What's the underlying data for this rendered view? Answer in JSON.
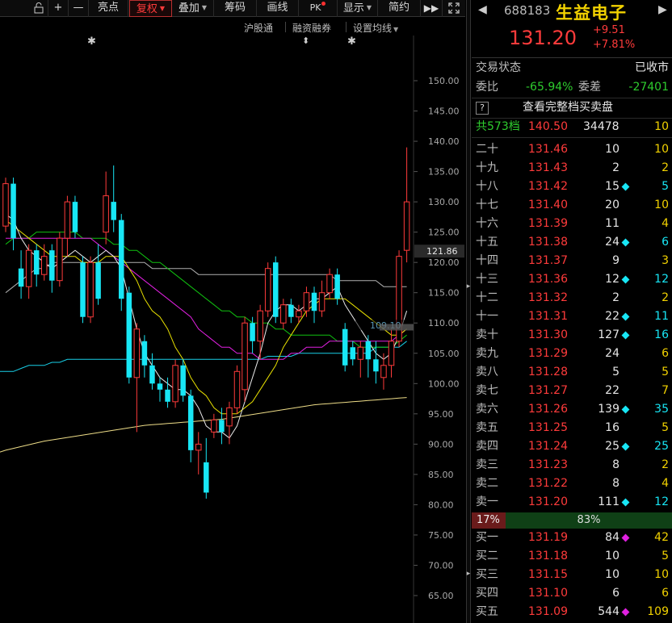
{
  "toolbar": {
    "items": [
      {
        "label": "",
        "icon": "lock-icon"
      },
      {
        "label": "+",
        "icon": "plus-icon"
      },
      {
        "label": "—",
        "icon": "minus-icon"
      },
      {
        "label": "亮点"
      },
      {
        "label": "复权",
        "active": true,
        "caret": true
      },
      {
        "label": "叠加",
        "caret": true
      },
      {
        "label": "筹码"
      },
      {
        "label": "画线"
      },
      {
        "label": "PK"
      },
      {
        "label": "显示",
        "caret": true
      },
      {
        "label": "简约"
      }
    ],
    "more_icon": "double-chevron-right-icon",
    "fullscreen_icon": "fullscreen-icon"
  },
  "chart_options": {
    "hgt": "沪股通",
    "margin": "融资融券",
    "ma_settings": "设置均线",
    "markers": [
      "✱",
      "⬍",
      "✱"
    ]
  },
  "chart": {
    "price_axis": [
      "150.00",
      "145.00",
      "140.00",
      "135.00",
      "130.00",
      "125.00",
      "120.00",
      "115.00",
      "110.00",
      "105.00",
      "100.00",
      "95.00",
      "90.00",
      "85.00",
      "80.00",
      "75.00",
      "70.00",
      "65.00"
    ],
    "current_price_tag": "121.86",
    "annotation": "109.10",
    "colors": {
      "up": "#ff3b3b",
      "down": "#18e6f5",
      "ma5": "#e8e8e8",
      "ma10": "#e8e000",
      "ma20": "#e020e0",
      "ma30": "#10c010",
      "ma60": "#b0b0b0",
      "ma120": "#18d0e8",
      "ma250": "#eedd88"
    }
  },
  "chart_data": {
    "type": "candlestick",
    "ylim": [
      62,
      153
    ],
    "candles": [
      {
        "o": 126,
        "c": 133,
        "h": 134,
        "l": 125
      },
      {
        "o": 133,
        "c": 124,
        "h": 134,
        "l": 122
      },
      {
        "o": 119,
        "c": 116,
        "h": 122,
        "l": 114
      },
      {
        "o": 116,
        "c": 122,
        "h": 123,
        "l": 114
      },
      {
        "o": 122,
        "c": 118,
        "h": 123,
        "l": 116
      },
      {
        "o": 118,
        "c": 121,
        "h": 123,
        "l": 117
      },
      {
        "o": 122,
        "c": 117,
        "h": 123,
        "l": 115
      },
      {
        "o": 117,
        "c": 124,
        "h": 125,
        "l": 116
      },
      {
        "o": 124,
        "c": 130,
        "h": 131,
        "l": 121
      },
      {
        "o": 130,
        "c": 125,
        "h": 131,
        "l": 124
      },
      {
        "o": 120,
        "c": 111,
        "h": 121,
        "l": 110
      },
      {
        "o": 111,
        "c": 120,
        "h": 121,
        "l": 110
      },
      {
        "o": 120,
        "c": 114,
        "h": 123,
        "l": 113
      },
      {
        "o": 125,
        "c": 131,
        "h": 135,
        "l": 123
      },
      {
        "o": 130,
        "c": 127,
        "h": 136,
        "l": 125
      },
      {
        "o": 127,
        "c": 114,
        "h": 128,
        "l": 112
      },
      {
        "o": 115,
        "c": 101,
        "h": 116,
        "l": 100
      },
      {
        "o": 101,
        "c": 109,
        "h": 110,
        "l": 92
      },
      {
        "o": 107,
        "c": 103,
        "h": 108,
        "l": 101
      },
      {
        "o": 103,
        "c": 100,
        "h": 105,
        "l": 99
      },
      {
        "o": 100,
        "c": 99,
        "h": 101,
        "l": 97
      },
      {
        "o": 99,
        "c": 97,
        "h": 101,
        "l": 96
      },
      {
        "o": 97,
        "c": 103,
        "h": 104,
        "l": 96
      },
      {
        "o": 103,
        "c": 98,
        "h": 104,
        "l": 97
      },
      {
        "o": 98,
        "c": 89,
        "h": 99,
        "l": 87
      },
      {
        "o": 89,
        "c": 90,
        "h": 92,
        "l": 85
      },
      {
        "o": 87,
        "c": 82,
        "h": 91,
        "l": 81
      },
      {
        "o": 92,
        "c": 94,
        "h": 95,
        "l": 91
      },
      {
        "o": 94,
        "c": 92,
        "h": 96,
        "l": 90
      },
      {
        "o": 93,
        "c": 96,
        "h": 97,
        "l": 90
      },
      {
        "o": 96,
        "c": 102,
        "h": 103,
        "l": 95
      },
      {
        "o": 99,
        "c": 110,
        "h": 111,
        "l": 97
      },
      {
        "o": 110,
        "c": 107,
        "h": 111,
        "l": 105
      },
      {
        "o": 107,
        "c": 112,
        "h": 113,
        "l": 104
      },
      {
        "o": 112,
        "c": 119,
        "h": 120,
        "l": 111
      },
      {
        "o": 120,
        "c": 111,
        "h": 121,
        "l": 110
      },
      {
        "o": 110,
        "c": 113,
        "h": 114,
        "l": 109
      },
      {
        "o": 113,
        "c": 111,
        "h": 114,
        "l": 110
      },
      {
        "o": 111,
        "c": 112,
        "h": 113,
        "l": 110
      },
      {
        "o": 112,
        "c": 115,
        "h": 116,
        "l": 111
      },
      {
        "o": 115,
        "c": 112,
        "h": 116,
        "l": 110
      },
      {
        "o": 112,
        "c": 115,
        "h": 117,
        "l": 111
      },
      {
        "o": 115,
        "c": 118,
        "h": 119,
        "l": 114
      },
      {
        "o": 118,
        "c": 114,
        "h": 119,
        "l": 113
      },
      {
        "o": 109,
        "c": 103,
        "h": 110,
        "l": 102
      },
      {
        "o": 106,
        "c": 104,
        "h": 107,
        "l": 103
      },
      {
        "o": 104,
        "c": 106,
        "h": 107,
        "l": 101
      },
      {
        "o": 107,
        "c": 104,
        "h": 108,
        "l": 101
      },
      {
        "o": 104,
        "c": 102,
        "h": 107,
        "l": 100
      },
      {
        "o": 101,
        "c": 103,
        "h": 105,
        "l": 99
      },
      {
        "o": 103,
        "c": 107,
        "h": 109,
        "l": 101
      },
      {
        "o": 107,
        "c": 121,
        "h": 122,
        "l": 106
      },
      {
        "o": 122,
        "c": 130,
        "h": 139,
        "l": 120
      }
    ],
    "ma5": [
      128,
      127,
      124,
      122,
      121,
      120,
      119,
      120,
      121,
      122,
      121,
      120,
      121,
      122,
      121,
      119,
      114,
      109,
      105,
      103,
      101,
      100,
      99,
      99,
      98,
      96,
      93,
      92,
      92,
      91,
      93,
      97,
      101,
      105,
      110,
      112,
      113,
      113,
      112,
      113,
      114,
      114,
      115,
      116,
      113,
      111,
      109,
      107,
      105,
      104,
      105,
      108,
      112
    ],
    "ma10": [
      127,
      126,
      125,
      124,
      123,
      122,
      121,
      121,
      121,
      121,
      120,
      120,
      120,
      121,
      121,
      121,
      119,
      117,
      114,
      112,
      111,
      109,
      106,
      104,
      101,
      99,
      98,
      96,
      95,
      95,
      95,
      96,
      97,
      99,
      101,
      103,
      106,
      108,
      110,
      112,
      113,
      114,
      114,
      114,
      114,
      113,
      112,
      111,
      110,
      109,
      108,
      108,
      109
    ],
    "ma20": [
      124,
      124,
      124,
      124,
      124,
      124,
      124,
      124,
      124,
      124,
      124,
      124,
      123,
      122,
      121,
      120,
      119,
      118,
      117,
      116,
      115,
      114,
      113,
      112,
      111,
      109,
      108,
      107,
      106,
      106,
      105,
      105,
      105,
      104,
      104,
      104,
      104,
      105,
      105,
      106,
      106,
      106,
      107,
      107,
      107,
      107,
      107,
      107,
      107,
      107,
      107,
      108,
      109
    ],
    "ma30": [
      123,
      124,
      124,
      124,
      125,
      125,
      125,
      125,
      125,
      125,
      124,
      124,
      124,
      124,
      123,
      123,
      122,
      122,
      121,
      120,
      120,
      119,
      118,
      117,
      116,
      115,
      114,
      113,
      112,
      112,
      111,
      111,
      110,
      110,
      110,
      109,
      109,
      108,
      108,
      108,
      108,
      108,
      108,
      107,
      107,
      107,
      106,
      106,
      106,
      106,
      106,
      107,
      108
    ],
    "ma60": [
      115,
      116,
      117,
      118,
      119,
      119,
      120,
      120,
      120,
      120,
      120,
      120,
      120,
      120,
      120,
      120,
      120,
      120,
      120,
      119,
      119,
      119,
      119,
      119,
      119,
      118,
      118,
      118,
      118,
      118,
      118,
      118,
      118,
      118,
      118,
      118,
      118,
      118,
      118,
      118,
      118,
      118,
      118,
      117,
      117,
      117,
      117,
      117,
      117,
      116,
      116,
      116,
      116
    ],
    "ma120": [
      102,
      102,
      102.5,
      103,
      103,
      103,
      103.5,
      103.5,
      104,
      104,
      104,
      104,
      104,
      104,
      104,
      104,
      104,
      104,
      104,
      104,
      104,
      104,
      104,
      104,
      104,
      104,
      104,
      104,
      104,
      104,
      104,
      104,
      104,
      104,
      104.5,
      104.5,
      104.5,
      104.5,
      105,
      105,
      105,
      105,
      105,
      105,
      105,
      105,
      105,
      105,
      106,
      106,
      106,
      106,
      107
    ],
    "ma250": [
      89,
      89.3,
      89.6,
      89.9,
      90.2,
      90.5,
      90.7,
      90.9,
      91.1,
      91.3,
      91.5,
      91.7,
      91.9,
      92.1,
      92.3,
      92.5,
      92.7,
      92.9,
      93.1,
      93.2,
      93.3,
      93.4,
      93.5,
      93.6,
      93.7,
      93.8,
      93.9,
      94,
      94.1,
      94.3,
      94.5,
      94.7,
      94.9,
      95.1,
      95.3,
      95.5,
      95.7,
      95.9,
      96.1,
      96.3,
      96.5,
      96.6,
      96.7,
      96.8,
      96.9,
      97,
      97.1,
      97.2,
      97.3,
      97.4,
      97.5,
      97.6,
      97.7
    ]
  },
  "panel": {
    "code": "688183",
    "name": "生益电子",
    "price": "131.20",
    "change": "+9.51",
    "change_pct": "+7.81%",
    "status_label": "交易状态",
    "status_value": "已收市",
    "wb_label": "委比",
    "wb_value": "-65.94%",
    "wc_label": "委差",
    "wc_value": "-27401",
    "full_book": "查看完整档买卖盘",
    "total_levels": "共573档",
    "total_price": "140.50",
    "total_vol": "34478",
    "total_cnt": "10",
    "asks": [
      {
        "label": "二十",
        "price": "131.46",
        "vol": "10",
        "cnt": "10",
        "dot": ""
      },
      {
        "label": "十九",
        "price": "131.43",
        "vol": "2",
        "cnt": "2",
        "dot": ""
      },
      {
        "label": "十八",
        "price": "131.42",
        "vol": "15",
        "cnt": "5",
        "dot": "#18e6f5"
      },
      {
        "label": "十七",
        "price": "131.40",
        "vol": "20",
        "cnt": "10",
        "dot": ""
      },
      {
        "label": "十六",
        "price": "131.39",
        "vol": "11",
        "cnt": "4",
        "dot": ""
      },
      {
        "label": "十五",
        "price": "131.38",
        "vol": "24",
        "cnt": "6",
        "dot": "#18e6f5"
      },
      {
        "label": "十四",
        "price": "131.37",
        "vol": "9",
        "cnt": "3",
        "dot": ""
      },
      {
        "label": "十三",
        "price": "131.36",
        "vol": "12",
        "cnt": "12",
        "dot": "#18e6f5"
      },
      {
        "label": "十二",
        "price": "131.32",
        "vol": "2",
        "cnt": "2",
        "dot": ""
      },
      {
        "label": "十一",
        "price": "131.31",
        "vol": "22",
        "cnt": "11",
        "dot": "#18e6f5"
      },
      {
        "label": "卖十",
        "price": "131.30",
        "vol": "127",
        "cnt": "16",
        "dot": "#18e6f5"
      },
      {
        "label": "卖九",
        "price": "131.29",
        "vol": "24",
        "cnt": "6",
        "dot": ""
      },
      {
        "label": "卖八",
        "price": "131.28",
        "vol": "5",
        "cnt": "5",
        "dot": ""
      },
      {
        "label": "卖七",
        "price": "131.27",
        "vol": "22",
        "cnt": "7",
        "dot": ""
      },
      {
        "label": "卖六",
        "price": "131.26",
        "vol": "139",
        "cnt": "35",
        "dot": "#18e6f5"
      },
      {
        "label": "卖五",
        "price": "131.25",
        "vol": "16",
        "cnt": "5",
        "dot": ""
      },
      {
        "label": "卖四",
        "price": "131.24",
        "vol": "25",
        "cnt": "25",
        "dot": "#18e6f5"
      },
      {
        "label": "卖三",
        "price": "131.23",
        "vol": "8",
        "cnt": "2",
        "dot": ""
      },
      {
        "label": "卖二",
        "price": "131.22",
        "vol": "8",
        "cnt": "4",
        "dot": ""
      },
      {
        "label": "卖一",
        "price": "131.20",
        "vol": "111",
        "cnt": "12",
        "dot": "#18e6f5"
      }
    ],
    "ratio_left": "17%",
    "ratio_right": "83%",
    "bids": [
      {
        "label": "买一",
        "price": "131.19",
        "vol": "84",
        "cnt": "42",
        "dot": "#e020e0"
      },
      {
        "label": "买二",
        "price": "131.18",
        "vol": "10",
        "cnt": "5",
        "dot": ""
      },
      {
        "label": "买三",
        "price": "131.15",
        "vol": "10",
        "cnt": "10",
        "dot": ""
      },
      {
        "label": "买四",
        "price": "131.10",
        "vol": "6",
        "cnt": "6",
        "dot": ""
      },
      {
        "label": "买五",
        "price": "131.09",
        "vol": "544",
        "cnt": "109",
        "dot": "#e020e0"
      }
    ]
  }
}
